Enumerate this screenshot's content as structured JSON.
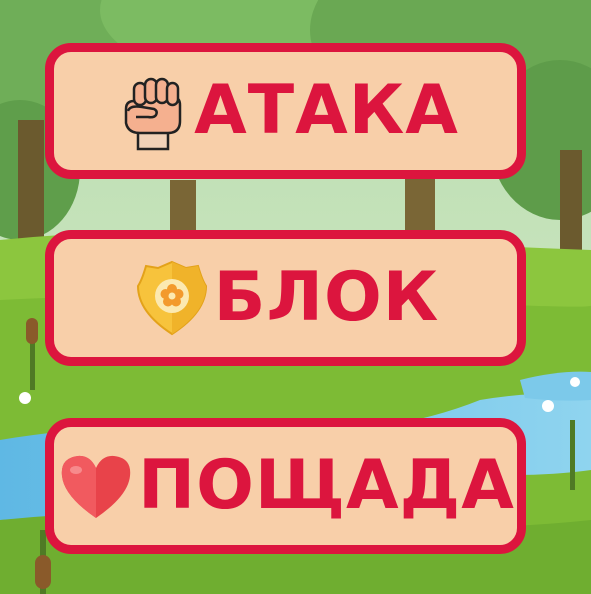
{
  "buttons": [
    {
      "label": "АТАКА",
      "icon": "fist-icon"
    },
    {
      "label": "БЛОК",
      "icon": "shield-badge-icon"
    },
    {
      "label": "ПОЩАДА",
      "icon": "heart-icon"
    }
  ],
  "colors": {
    "button_fill": "#f8cfa9",
    "button_border": "#dc153e",
    "button_text": "#dc153e"
  }
}
